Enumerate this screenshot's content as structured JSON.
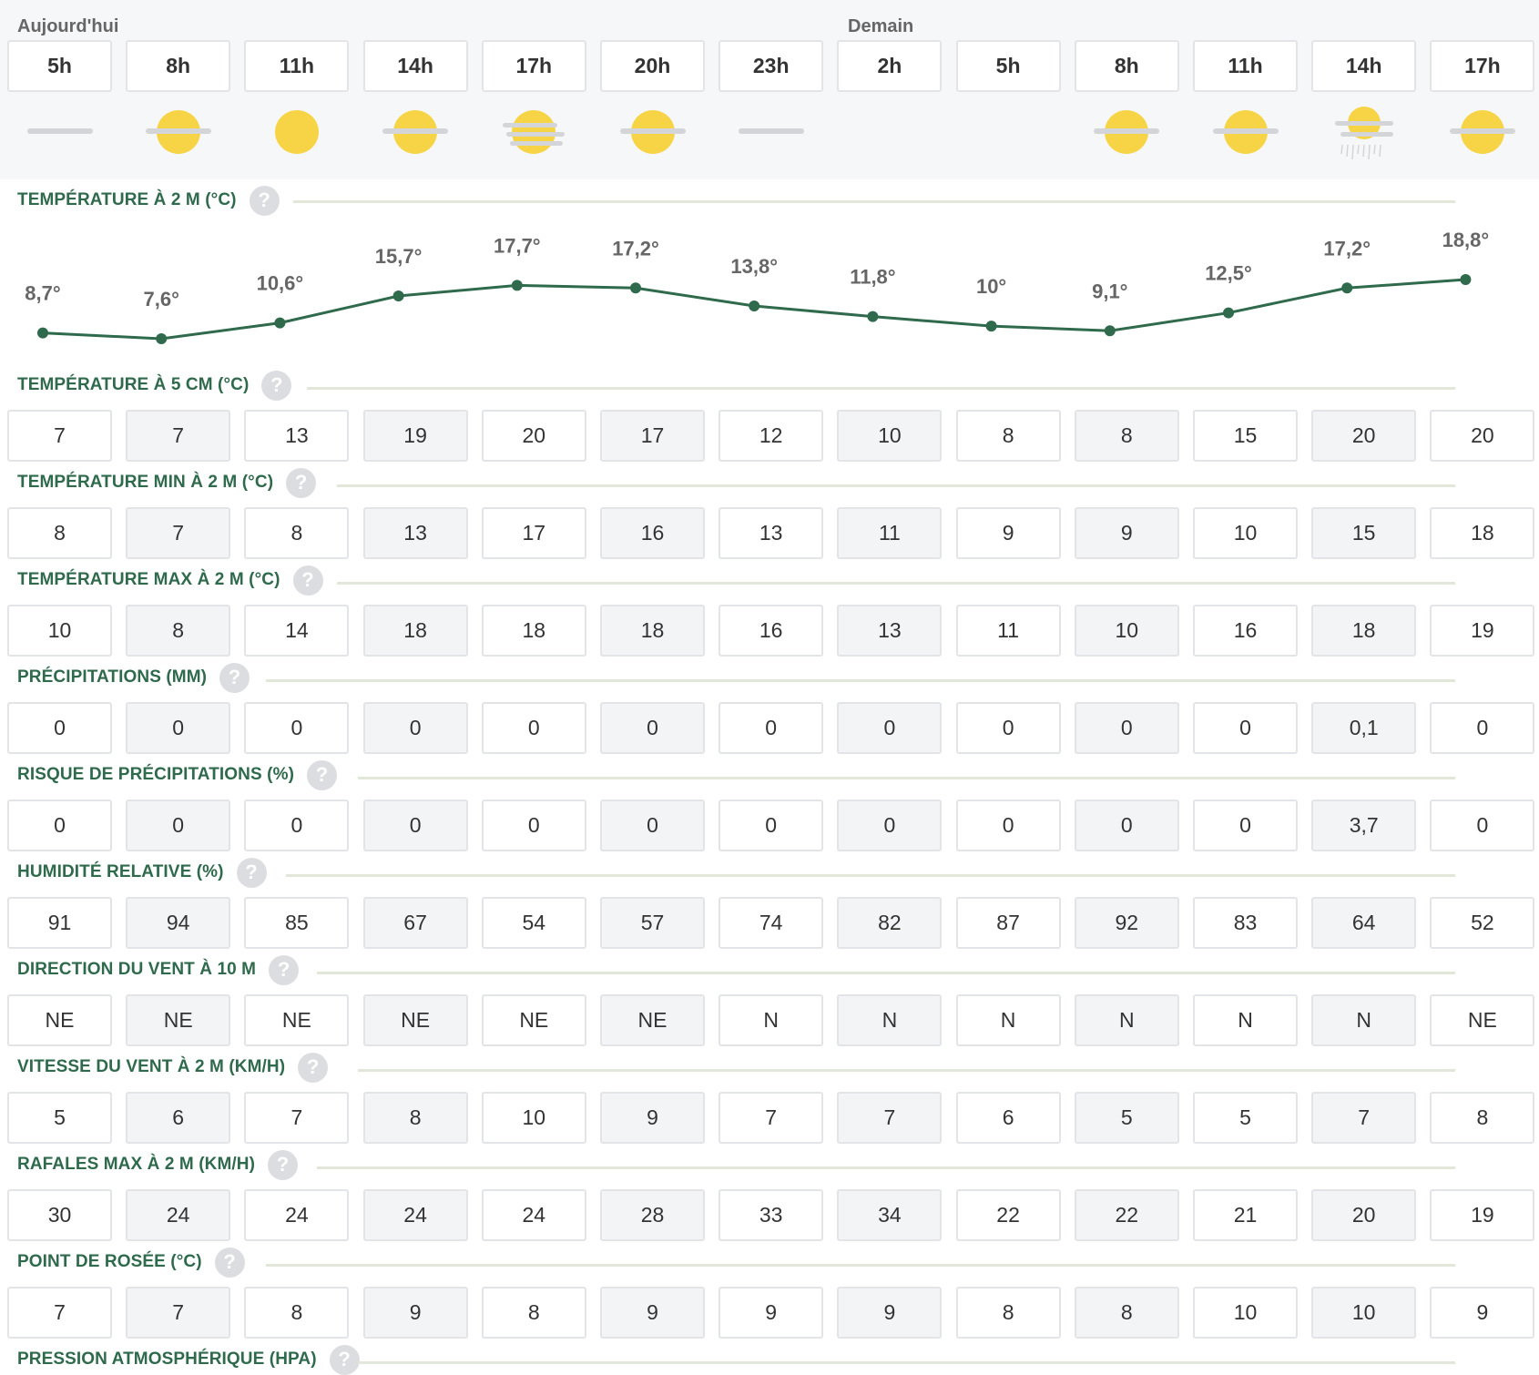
{
  "header": {
    "day_today": "Aujourd'hui",
    "day_tomorrow": "Demain"
  },
  "hours": [
    "5h",
    "8h",
    "11h",
    "14h",
    "17h",
    "20h",
    "23h",
    "2h",
    "5h",
    "8h",
    "11h",
    "14h",
    "17h"
  ],
  "icons": [
    "moon-cloud-icon",
    "sun-cloud-icon",
    "sun-icon",
    "sun-cloud-icon",
    "sun-fog-icon",
    "sun-cloud-icon",
    "moon-cloud-icon",
    "moon-icon",
    "moon-icon",
    "sun-cloud-icon",
    "sun-cloud-icon",
    "sun-rain-icon",
    "sun-cloud-icon"
  ],
  "colors": {
    "accent_green": "#2e6a4b",
    "sun_yellow": "#f7d446",
    "moon_lavender": "#a7a6c4",
    "cloud_grey": "#d4d5d8"
  },
  "chart_data": {
    "type": "line",
    "title": "TEMPÉRATURE À 2 M (°C)",
    "x": [
      "5h",
      "8h",
      "11h",
      "14h",
      "17h",
      "20h",
      "23h",
      "2h",
      "5h",
      "8h",
      "11h",
      "14h",
      "17h"
    ],
    "values": [
      8.7,
      7.6,
      10.6,
      15.7,
      17.7,
      17.2,
      13.8,
      11.8,
      10.0,
      9.1,
      12.5,
      17.2,
      18.8
    ],
    "labels": [
      "8,7°",
      "7,6°",
      "10,6°",
      "15,7°",
      "17,7°",
      "17,2°",
      "13,8°",
      "11,8°",
      "10°",
      "9,1°",
      "12,5°",
      "17,2°",
      "18,8°"
    ],
    "ylim": [
      7.6,
      18.8
    ],
    "grid": false,
    "line_color": "#2e6a4b"
  },
  "sections": [
    {
      "title": "TEMPÉRATURE À 5 CM (°C)",
      "values": [
        "7",
        "7",
        "13",
        "19",
        "20",
        "17",
        "12",
        "10",
        "8",
        "8",
        "15",
        "20",
        "20"
      ]
    },
    {
      "title": "TEMPÉRATURE MIN À 2 M (°C)",
      "values": [
        "8",
        "7",
        "8",
        "13",
        "17",
        "16",
        "13",
        "11",
        "9",
        "9",
        "10",
        "15",
        "18"
      ]
    },
    {
      "title": "TEMPÉRATURE MAX À 2 M (°C)",
      "values": [
        "10",
        "8",
        "14",
        "18",
        "18",
        "18",
        "16",
        "13",
        "11",
        "10",
        "16",
        "18",
        "19"
      ]
    },
    {
      "title": "PRÉCIPITATIONS (MM)",
      "values": [
        "0",
        "0",
        "0",
        "0",
        "0",
        "0",
        "0",
        "0",
        "0",
        "0",
        "0",
        "0,1",
        "0"
      ]
    },
    {
      "title": "RISQUE DE PRÉCIPITATIONS (%)",
      "values": [
        "0",
        "0",
        "0",
        "0",
        "0",
        "0",
        "0",
        "0",
        "0",
        "0",
        "0",
        "3,7",
        "0"
      ]
    },
    {
      "title": "HUMIDITÉ RELATIVE (%)",
      "values": [
        "91",
        "94",
        "85",
        "67",
        "54",
        "57",
        "74",
        "82",
        "87",
        "92",
        "83",
        "64",
        "52"
      ]
    },
    {
      "title": "DIRECTION DU VENT À 10 M",
      "values": [
        "NE",
        "NE",
        "NE",
        "NE",
        "NE",
        "NE",
        "N",
        "N",
        "N",
        "N",
        "N",
        "N",
        "NE"
      ]
    },
    {
      "title": "VITESSE DU VENT À 2 M (KM/H)",
      "values": [
        "5",
        "6",
        "7",
        "8",
        "10",
        "9",
        "7",
        "7",
        "6",
        "5",
        "5",
        "7",
        "8"
      ]
    },
    {
      "title": "RAFALES MAX À 2 M (KM/H)",
      "values": [
        "30",
        "24",
        "24",
        "24",
        "24",
        "28",
        "33",
        "34",
        "22",
        "22",
        "21",
        "20",
        "19"
      ]
    },
    {
      "title": "POINT DE ROSÉE (°C)",
      "values": [
        "7",
        "7",
        "8",
        "9",
        "8",
        "9",
        "9",
        "9",
        "8",
        "8",
        "10",
        "10",
        "9"
      ]
    },
    {
      "title": "PRESSION ATMOSPHÉRIQUE (HPA)",
      "values": []
    }
  ],
  "temp_section_title": "TEMPÉRATURE À 2 M (°C)",
  "help_glyph": "?"
}
